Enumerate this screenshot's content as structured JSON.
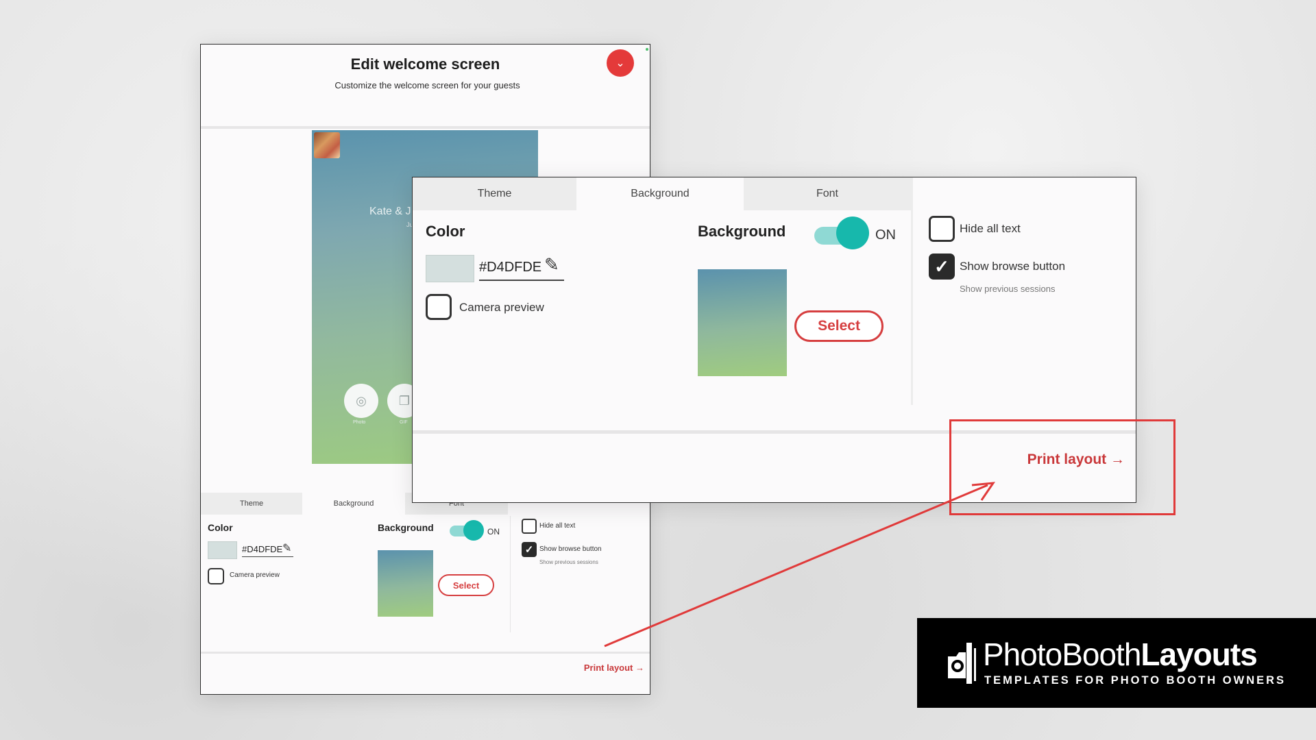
{
  "small_panel": {
    "title": "Edit welcome screen",
    "subtitle": "Customize the welcome screen for your guests",
    "chevron_glyph": "⌄",
    "preview": {
      "names": "Kate & J",
      "date_fragment": "Ju",
      "photo_label": "Photo",
      "gif_label": "GIF",
      "photo_icon_glyph": "◎",
      "gif_icon_glyph": "❐"
    },
    "tabs": [
      "Theme",
      "Background",
      "Font"
    ],
    "color_label": "Color",
    "color_hex": "#D4DFDE",
    "pen_glyph": "✎",
    "camera_preview_label": "Camera preview",
    "background_label": "Background",
    "toggle_state": "ON",
    "select_label": "Select",
    "hide_all_text_label": "Hide all text",
    "show_browse_label": "Show browse button",
    "show_previous_label": "Show previous sessions",
    "check_glyph": "✓",
    "print_layout_label": "Print layout →"
  },
  "big_panel": {
    "tabs": [
      "Theme",
      "Background",
      "Font"
    ],
    "active_tab": "Background",
    "color_label": "Color",
    "color_hex": "#D4DFDE",
    "pen_glyph": "✎",
    "camera_preview_label": "Camera preview",
    "background_label": "Background",
    "toggle_state": "ON",
    "select_label": "Select",
    "hide_all_text_label": "Hide all text",
    "show_browse_label": "Show browse button",
    "show_previous_label": "Show previous sessions",
    "check_glyph": "✓",
    "print_layout_label": "Print layout →"
  },
  "logo": {
    "name_light": "PhotoBooth",
    "name_bold": "Layouts",
    "tagline": "TEMPLATES FOR PHOTO BOOTH OWNERS"
  },
  "colors": {
    "accent_red": "#D63F40",
    "toggle_teal": "#17B8AC",
    "swatch": "#D4DFDE",
    "annotation_red": "#E03A3A"
  },
  "icons": [
    "chevron-down-icon",
    "pen-icon",
    "check-icon",
    "photo-icon",
    "gif-icon",
    "arrow-right-icon",
    "logo-camera-icon"
  ]
}
